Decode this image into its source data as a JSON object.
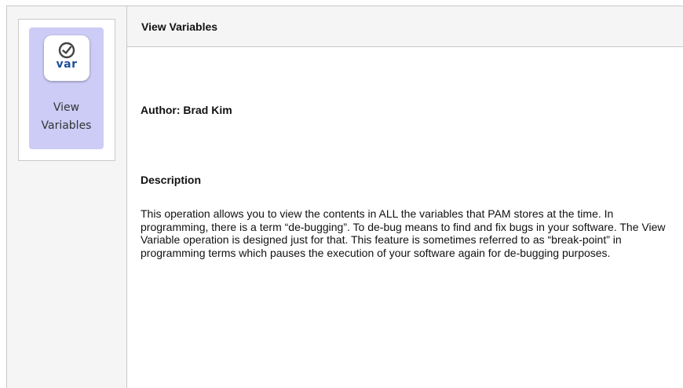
{
  "sidebar": {
    "icon": {
      "name": "view-variables-icon",
      "badge_text": "var",
      "check_color": "#444444",
      "badge_color": "#1f4e9a",
      "tile_color": "#ccccf6"
    },
    "label_line1": "View",
    "label_line2": "Variables"
  },
  "header": {
    "title": "View Variables"
  },
  "content": {
    "author": "Author: Brad Kim",
    "description_heading": "Description",
    "description_body": "This operation allows you to view the contents in ALL the variables that PAM stores at the time. In programming, there is a term “de-bugging”. To de-bug means to find and fix bugs in your software. The View Variable operation is designed just for that. This feature is sometimes referred to as “break-point” in programming terms which pauses the execution of your software again for de-bugging purposes."
  }
}
